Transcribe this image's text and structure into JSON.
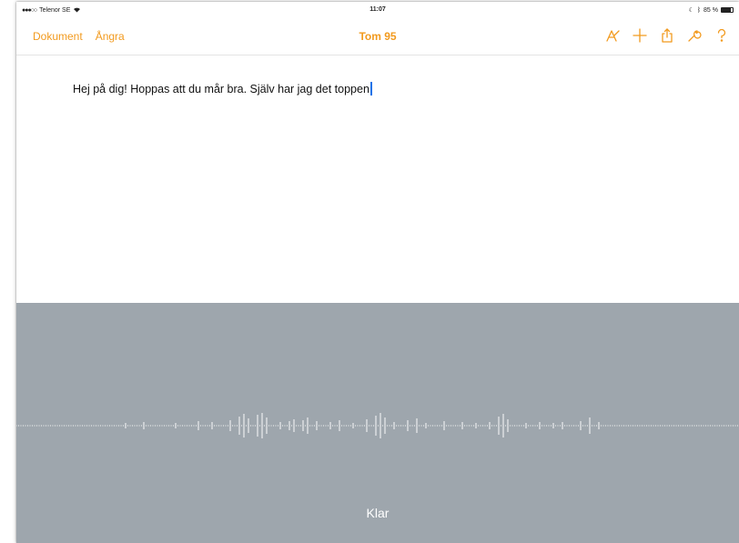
{
  "status_bar": {
    "carrier": "Telenor SE",
    "time": "11:07",
    "battery_text": "85 %",
    "battery_level": 0.85
  },
  "toolbar": {
    "documents_label": "Dokument",
    "undo_label": "Ångra",
    "title": "Tom 95",
    "icons": [
      "format-brush-icon",
      "add-icon",
      "share-icon",
      "wrench-icon",
      "help-icon"
    ]
  },
  "document": {
    "text": "Hej på dig! Hoppas att du mår bra. Själv har jag det toppen"
  },
  "dictation": {
    "done_label": "Klar"
  },
  "colors": {
    "accent": "#f29a1e",
    "dictation_bg": "#9ea6ad",
    "cursor": "#1a73e8"
  }
}
